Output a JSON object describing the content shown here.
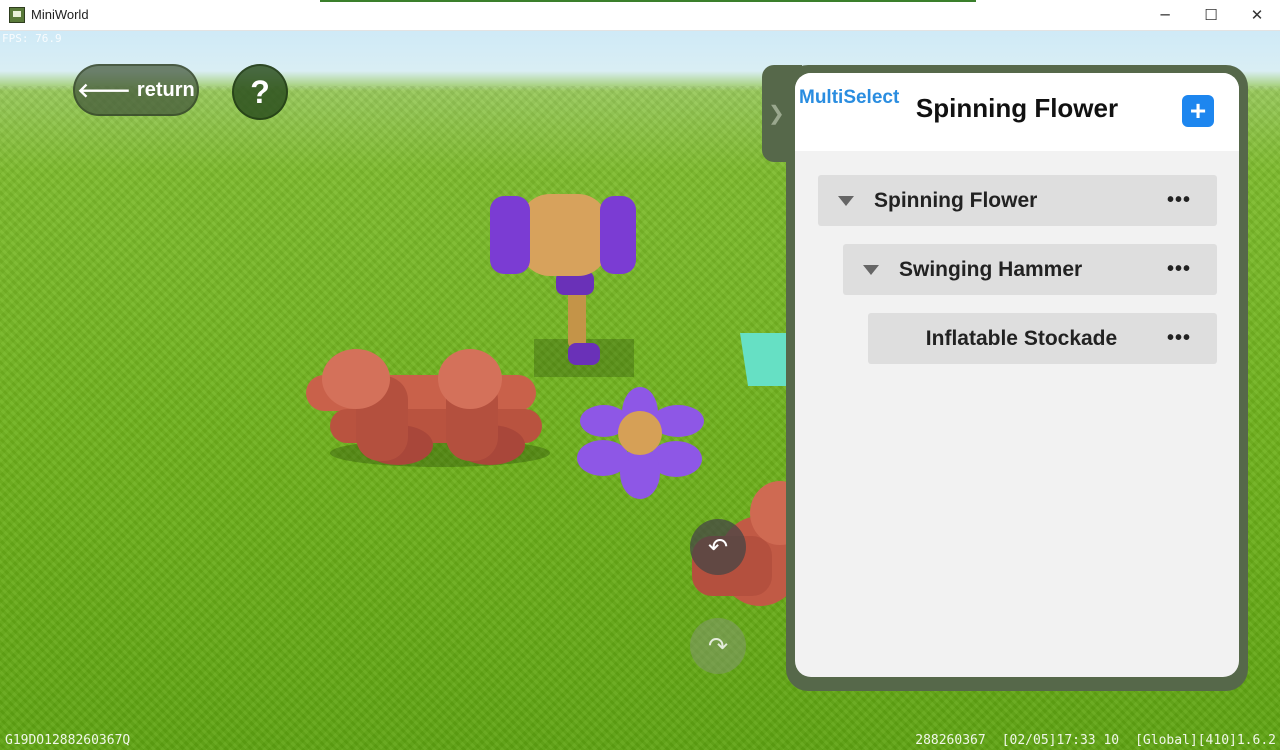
{
  "window": {
    "title": "MiniWorld",
    "minimize_icon": "─",
    "maximize_icon": "☐",
    "close_icon": "✕"
  },
  "hud": {
    "fps": "FPS: 76.9",
    "return_label": "return",
    "return_icon": "arrow-left-icon",
    "help_label": "?",
    "undo_icon": "undo-icon",
    "redo_icon": "redo-icon"
  },
  "panel": {
    "multiselect_label": "MultiSelect",
    "title": "Spinning Flower",
    "add_label": "+",
    "items": [
      {
        "label": "Spinning Flower",
        "menu": "•••",
        "expanded": true
      },
      {
        "label": "Swinging Hammer",
        "menu": "•••",
        "expanded": true
      },
      {
        "label": "Inflatable Stockade",
        "menu": "•••",
        "expanded": false
      }
    ]
  },
  "footer": {
    "device_id": "G19DO1288260367Q",
    "uid": "288260367",
    "timestamp": "[02/05]17:33 10",
    "server": "[Global][410]1.6.2"
  },
  "colors": {
    "panel_frame": "#56684a",
    "accent_blue": "#1d86ef",
    "multiselect_blue": "#2a8de0",
    "grass": "#6fb21c"
  }
}
